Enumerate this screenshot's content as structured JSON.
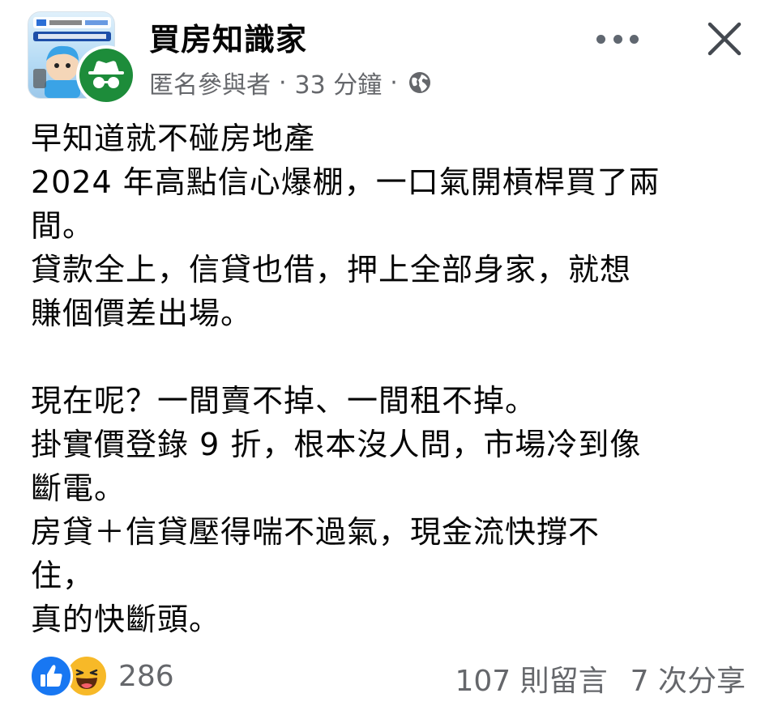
{
  "header": {
    "group_name": "買房知識家",
    "author": "匿名參與者",
    "separator": "·",
    "timestamp": "33 分鐘",
    "privacy_icon": "globe-icon",
    "more_icon": "more-horizontal-icon",
    "close_icon": "close-icon",
    "group_avatar_icon": "group-avatar-image",
    "user_avatar_icon": "anonymous-member-icon"
  },
  "post": {
    "lines": [
      "早知道就不碰房地產",
      "2024 年高點信心爆棚，一口氣開槓桿買了兩",
      "間。",
      "貸款全上，信貸也借，押上全部身家，就想",
      "賺個價差出場。",
      "",
      "現在呢？一間賣不掉、一間租不掉。",
      "掛實價登錄 9 折，根本沒人問，市場冷到像",
      "斷電。",
      "房貸＋信貸壓得喘不過氣，現金流快撐不",
      "住，",
      "真的快斷頭。"
    ]
  },
  "footer": {
    "reaction_icons": [
      "like-icon",
      "haha-icon"
    ],
    "reaction_count": "286",
    "comments": "107 則留言",
    "shares": "7 次分享"
  },
  "colors": {
    "text": "#050505",
    "secondary_text": "#65676b",
    "like_blue": "#1877f2",
    "haha_yellow": "#f7b928",
    "anonymous_green": "#1d8c3a"
  }
}
